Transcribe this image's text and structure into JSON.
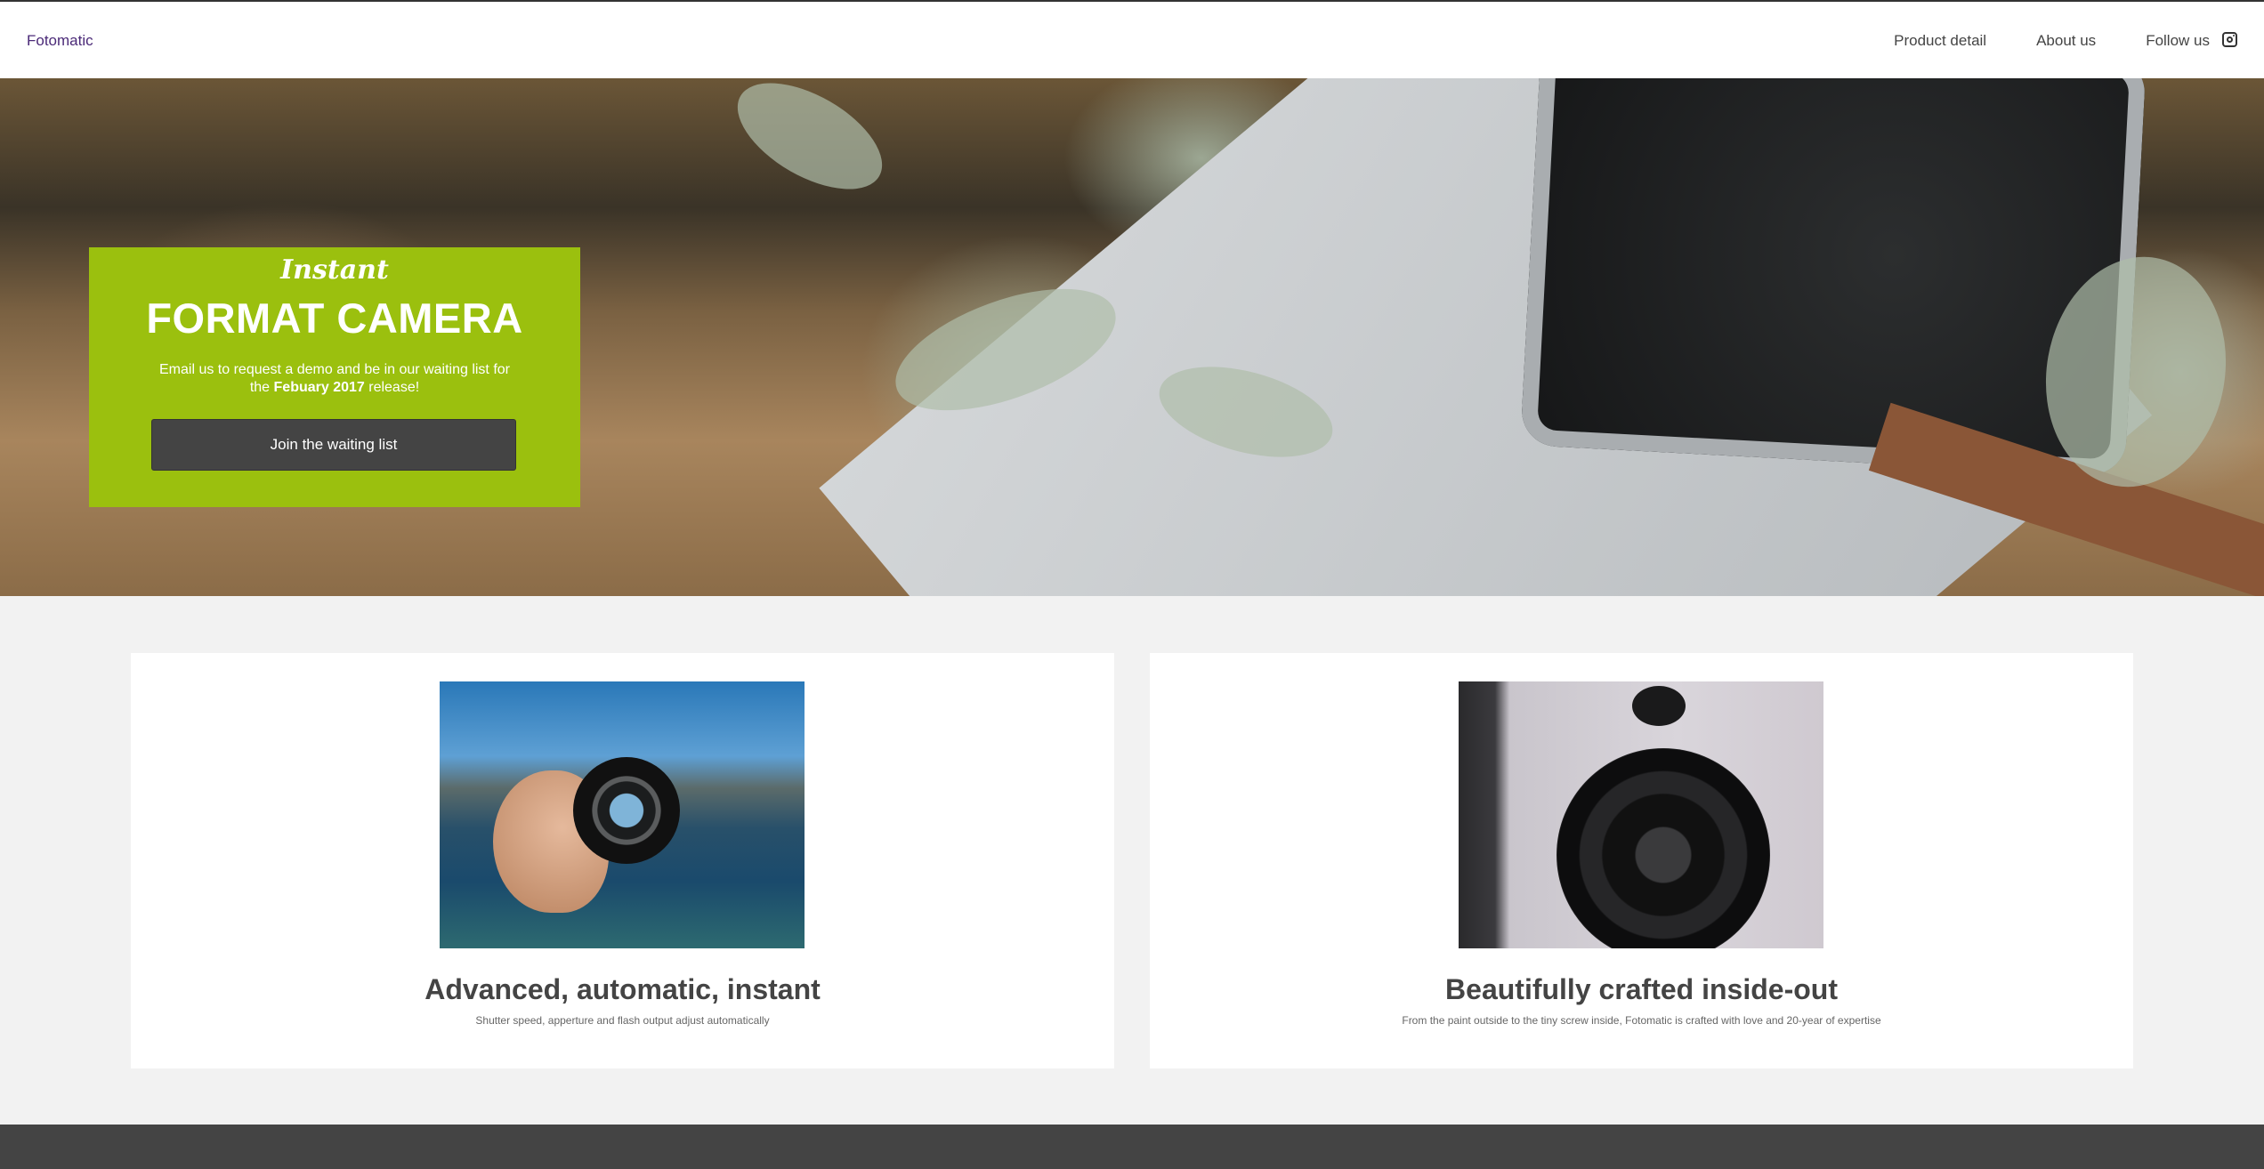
{
  "nav": {
    "brand": "Fotomatic",
    "links": [
      "Product detail",
      "About us",
      "Follow us"
    ],
    "social_icon": "instagram-icon"
  },
  "hero": {
    "script_title": "Instant",
    "title": "FORMAT CAMERA",
    "text_before": "Email us to request a demo and be in our waiting list for the ",
    "text_bold": "Febuary 2017",
    "text_after": " release!",
    "cta_label": "Join the waiting list",
    "accent_color": "#9bc00e"
  },
  "features": [
    {
      "image": "camera-lens-held-over-lake-image",
      "title": "Advanced, automatic, instant",
      "subtitle": "Shutter speed, apperture and flash output adjust automatically"
    },
    {
      "image": "instant-camera-lens-closeup-image",
      "title": "Beautifully crafted inside-out",
      "subtitle": "From the paint outside to the tiny screw inside, Fotomatic is crafted with love and 20-year of expertise"
    }
  ]
}
